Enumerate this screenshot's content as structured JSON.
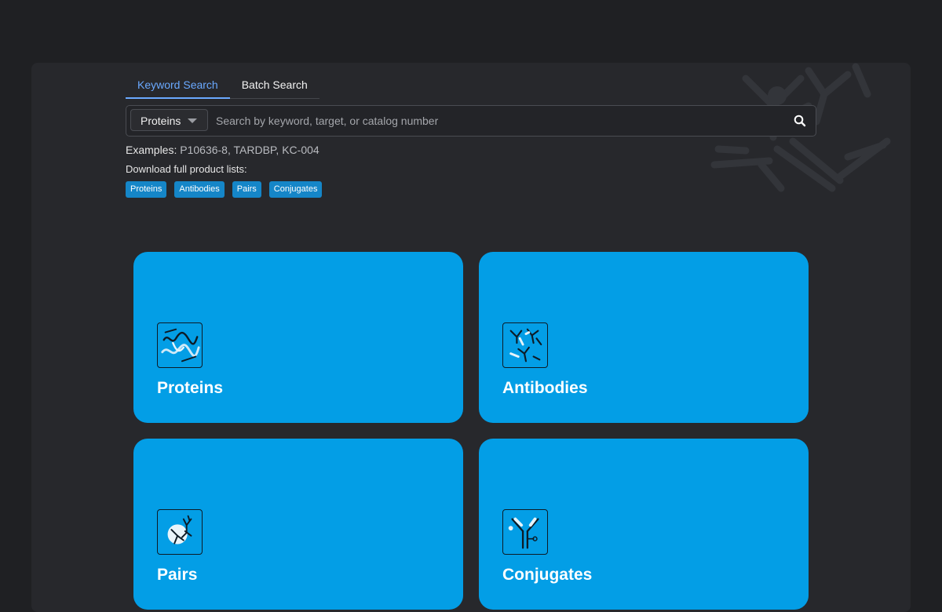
{
  "search_tabs": [
    {
      "label": "Keyword Search",
      "active": true
    },
    {
      "label": "Batch Search",
      "active": false
    }
  ],
  "search": {
    "selected_category": "Proteins",
    "placeholder": "Search by keyword, target, or catalog number",
    "value": ""
  },
  "examples": {
    "label": "Examples:",
    "values": "P10636-8, TARDBP, KC-004"
  },
  "download": {
    "label": "Download full product lists:",
    "chips": [
      "Proteins",
      "Antibodies",
      "Pairs",
      "Conjugates"
    ]
  },
  "cards": [
    {
      "title": "Proteins",
      "icon": "protein-icon"
    },
    {
      "title": "Antibodies",
      "icon": "antibodies-icon"
    },
    {
      "title": "Pairs",
      "icon": "pairs-icon"
    },
    {
      "title": "Conjugates",
      "icon": "conjugate-icon"
    }
  ],
  "colors": {
    "page_background": "#1f2023",
    "panel_background": "#27282c",
    "card_blue": "#039ee6",
    "chip_blue": "#1586c8",
    "active_tab": "#6aa9ff"
  }
}
